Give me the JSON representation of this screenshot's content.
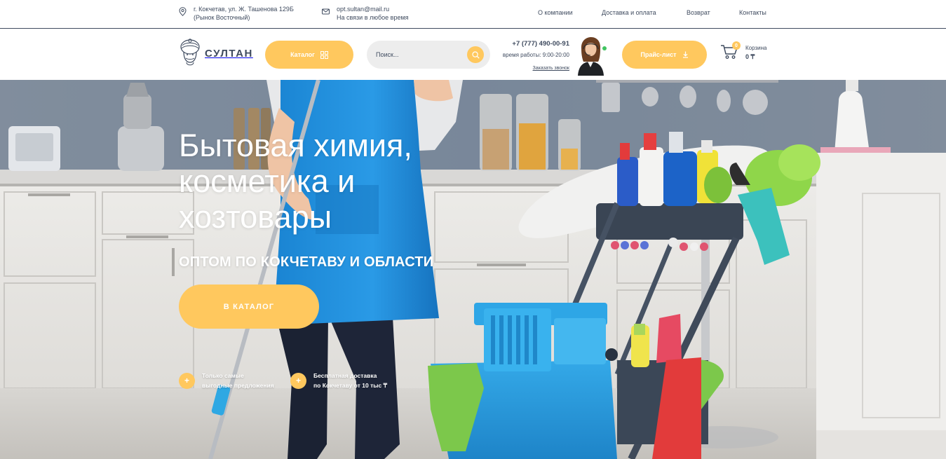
{
  "topbar": {
    "address_line1": "г. Кокчетав, ул. Ж. Ташенова 129Б",
    "address_line2": "(Рынок Восточный)",
    "email": "opt.sultan@mail.ru",
    "email_sub": "На связи в любое время",
    "nav": [
      "О компании",
      "Доставка и оплата",
      "Возврат",
      "Контакты"
    ],
    "address_icon": "location-pin-icon",
    "email_icon": "mail-icon"
  },
  "header": {
    "logo_text": "СУЛТАН",
    "catalog_label": "Каталог",
    "search_placeholder": "Поиск...",
    "phone": "+7 (777) 490-00-91",
    "hours": "время работы: 9:00-20:00",
    "callback": "Заказать звонок",
    "price_list_label": "Прайс-лист",
    "cart_label": "Корзина",
    "cart_sum": "0 ₸",
    "cart_count": "0"
  },
  "hero": {
    "title_lines": [
      "Бытовая химия,",
      "косметика и",
      "хозтовары"
    ],
    "subtitle": "ОПТОМ ПО КОКЧЕТАВУ И ОБЛАСТИ",
    "button": "В КАТАЛОГ",
    "features": [
      {
        "plus": "+",
        "line1": "Только самые",
        "line2": "выгодные предложения"
      },
      {
        "plus": "+",
        "line1": "Бесплатная доставка",
        "line2": "по Кокчетаву от 10 тыс ₸"
      }
    ]
  },
  "colors": {
    "accent": "#ffc85e",
    "text": "#3f4b5f",
    "search_bg": "#ededed",
    "online": "#41c461"
  }
}
